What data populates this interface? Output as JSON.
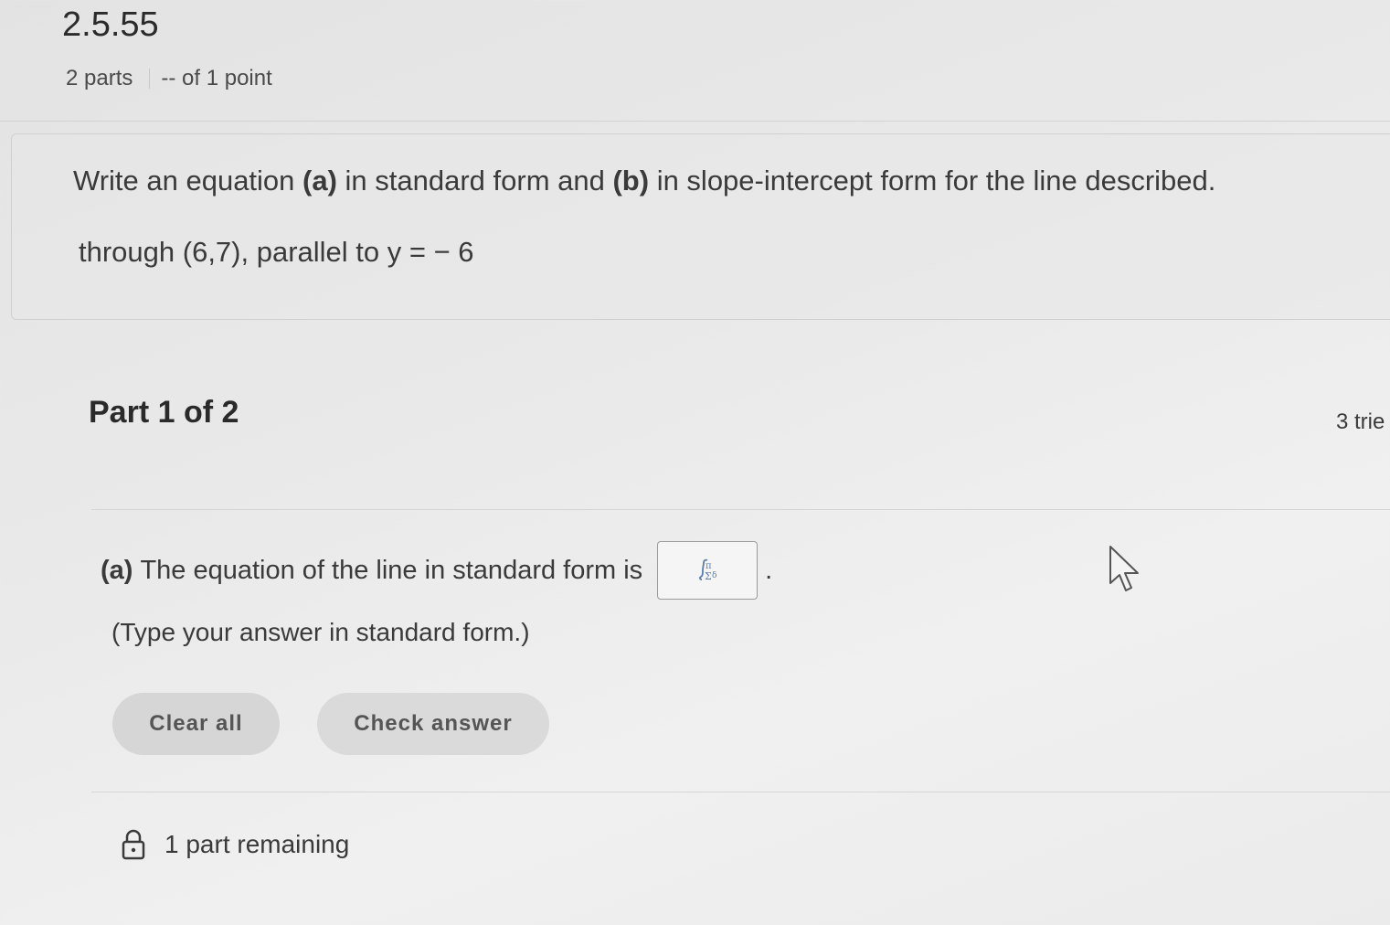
{
  "header": {
    "problem_id": "2.5.55",
    "parts": "2 parts",
    "points": "-- of 1 point"
  },
  "question": {
    "instr_1": "Write an equation ",
    "instr_a": "(a)",
    "instr_2": " in standard form and ",
    "instr_b": "(b)",
    "instr_3": " in slope-intercept form for the line described.",
    "condition": "through (6,7), parallel to y = − 6"
  },
  "part": {
    "title": "Part 1 of 2",
    "tries": "3 trie"
  },
  "answer": {
    "label": "(a)",
    "prompt": "The equation of the line in standard form is",
    "input_icon": "math-palette-icon",
    "period": ".",
    "hint": "(Type your answer in standard form.)"
  },
  "buttons": {
    "clear": "Clear all",
    "check": "Check answer"
  },
  "footer": {
    "remaining": "1 part remaining",
    "icon": "lock-icon"
  }
}
